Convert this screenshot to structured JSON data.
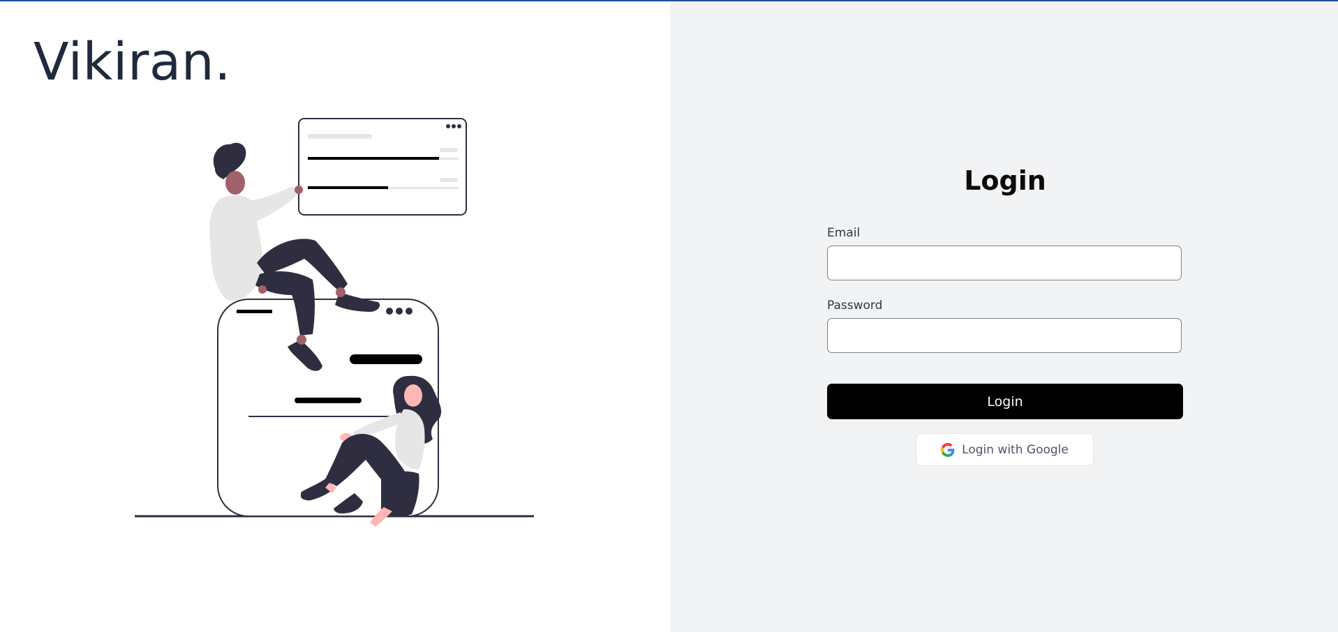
{
  "brand": {
    "name": "Vikiran."
  },
  "login": {
    "title": "Login",
    "email_label": "Email",
    "email_value": "",
    "password_label": "Password",
    "password_value": "",
    "submit_label": "Login",
    "google_label": "Login with Google"
  },
  "colors": {
    "accent_bar": "#1e4d9c",
    "right_panel_bg": "#f2f3f5",
    "primary_button": "#000000",
    "brand_text": "#1f2a3c"
  },
  "icons": {
    "google": "google-g-icon"
  }
}
